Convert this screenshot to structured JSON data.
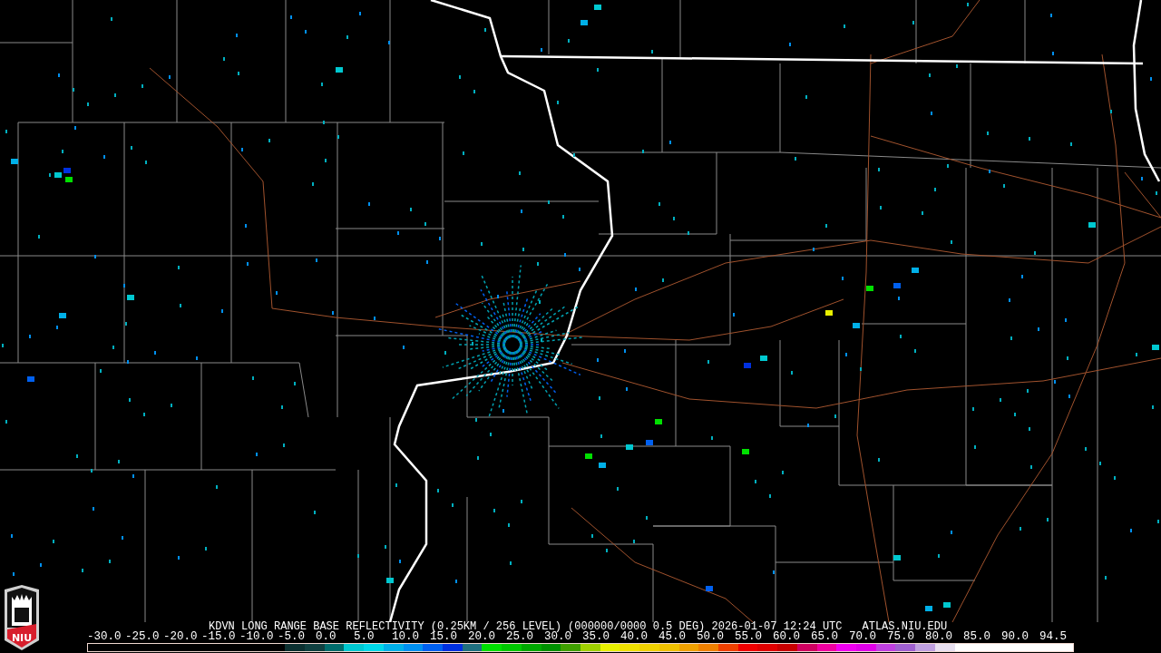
{
  "logo": {
    "text": "NIU"
  },
  "header": {
    "title": "KDVN LONG RANGE BASE REFLECTIVITY (0.25KM / 256 LEVEL) (000000/0000 0.5 DEG) 2026-01-07 12:24 UTC",
    "site": "ATLAS.NIU.EDU"
  },
  "scale_labels": [
    "-30.0",
    "-25.0",
    "-20.0",
    "-15.0",
    "-10.0",
    "-5.0",
    "0.0",
    "5.0",
    "10.0",
    "15.0",
    "20.0",
    "25.0",
    "30.0",
    "35.0",
    "40.0",
    "45.0",
    "50.0",
    "55.0",
    "60.0",
    "65.0",
    "70.0",
    "75.0",
    "80.0",
    "85.0",
    "90.0",
    "94.5"
  ],
  "colorbar": [
    {
      "color": "#000000"
    },
    {
      "color": "#000000"
    },
    {
      "color": "#000000"
    },
    {
      "color": "#000000"
    },
    {
      "color": "#000000"
    },
    {
      "color": "#000000"
    },
    {
      "color": "#000000"
    },
    {
      "color": "#000000"
    },
    {
      "color": "#000000"
    },
    {
      "color": "#000000"
    },
    {
      "color": "#0c3030"
    },
    {
      "color": "#104040"
    },
    {
      "color": "#006c6c"
    },
    {
      "color": "#00c8d0"
    },
    {
      "color": "#00d8e8"
    },
    {
      "color": "#00b0e8"
    },
    {
      "color": "#0090f0"
    },
    {
      "color": "#0060f0"
    },
    {
      "color": "#0030e0"
    },
    {
      "color": "#207080"
    },
    {
      "color": "#00e000"
    },
    {
      "color": "#00c800"
    },
    {
      "color": "#00a800"
    },
    {
      "color": "#009000"
    },
    {
      "color": "#40a000"
    },
    {
      "color": "#a0d000"
    },
    {
      "color": "#e8f000"
    },
    {
      "color": "#f0e000"
    },
    {
      "color": "#f0d000"
    },
    {
      "color": "#f0c000"
    },
    {
      "color": "#f0a000"
    },
    {
      "color": "#f08000"
    },
    {
      "color": "#f04000"
    },
    {
      "color": "#f00000"
    },
    {
      "color": "#e00000"
    },
    {
      "color": "#c80000"
    },
    {
      "color": "#d00060"
    },
    {
      "color": "#f000a0"
    },
    {
      "color": "#f000f0"
    },
    {
      "color": "#e000e8"
    },
    {
      "color": "#c040e0"
    },
    {
      "color": "#a060d0"
    },
    {
      "color": "#c0a0e0"
    },
    {
      "color": "#e8e0f0"
    },
    {
      "color": "#ffffff"
    },
    {
      "color": "#ffffff"
    },
    {
      "color": "#ffffff"
    },
    {
      "color": "#ffffff"
    },
    {
      "color": "#ffffff"
    },
    {
      "color": "#ffffff"
    }
  ]
}
